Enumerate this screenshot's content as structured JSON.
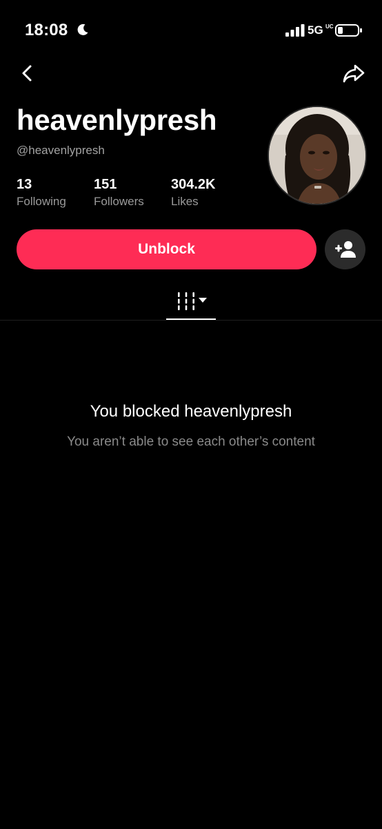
{
  "status_bar": {
    "time": "18:08",
    "network": "5G",
    "network_suffix": "UC"
  },
  "nav": {
    "back_icon": "chevron-left-icon",
    "share_icon": "share-arrow-icon"
  },
  "profile": {
    "display_name": "heavenlypresh",
    "username": "@heavenlypresh",
    "stats": [
      {
        "value": "13",
        "label": "Following"
      },
      {
        "value": "151",
        "label": "Followers"
      },
      {
        "value": "304.2K",
        "label": "Likes"
      }
    ]
  },
  "actions": {
    "unblock_label": "Unblock",
    "add_friend_icon": "add-person-icon",
    "accent_color": "#fe2c55"
  },
  "tabs": {
    "videos_icon": "grid-icon",
    "dropdown_icon": "caret-down-icon"
  },
  "blocked_state": {
    "title": "You blocked heavenlypresh",
    "subtitle": "You aren’t able to see each other’s content"
  }
}
